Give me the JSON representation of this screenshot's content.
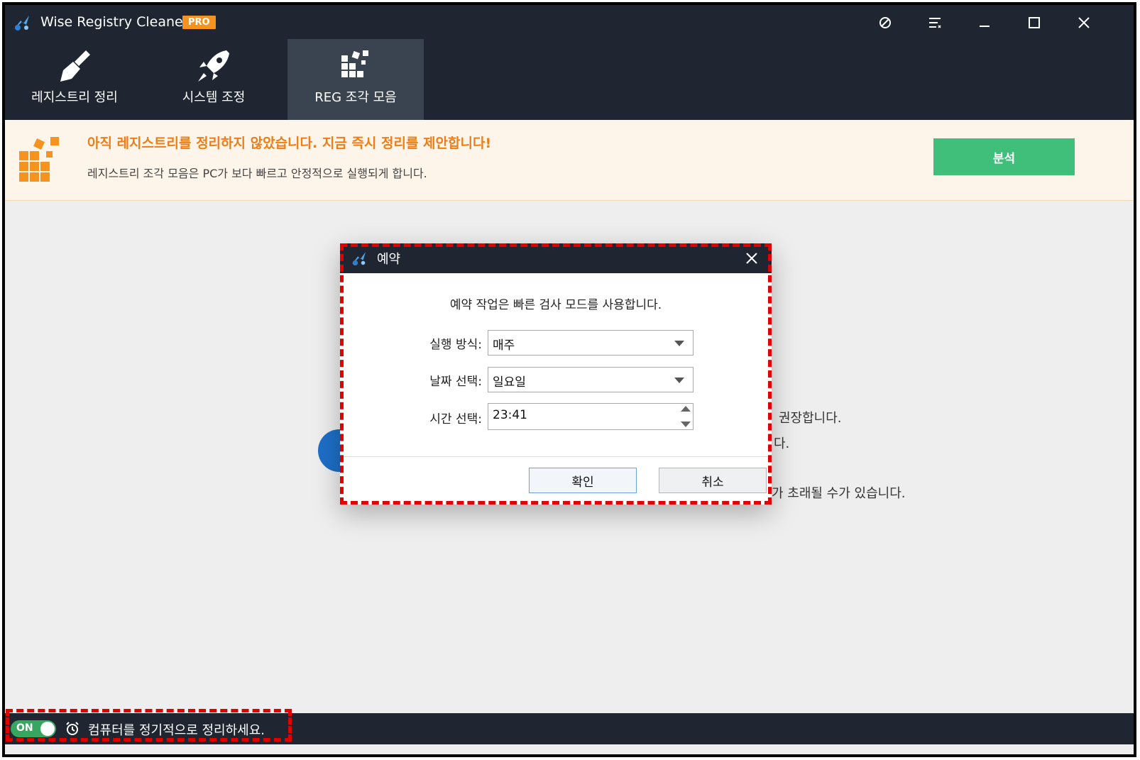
{
  "app": {
    "title": "Wise Registry Cleaner X",
    "badge": "PRO"
  },
  "window_controls": {
    "theme_icon": "theme-icon",
    "menu_icon": "menu-icon",
    "minimize_icon": "minimize-icon",
    "maximize_icon": "maximize-icon",
    "close_icon": "close-icon"
  },
  "tabs": [
    {
      "label": "레지스트리 정리",
      "icon": "broom-icon"
    },
    {
      "label": "시스템 조정",
      "icon": "rocket-icon"
    },
    {
      "label": "REG 조각 모음",
      "icon": "defrag-blocks-icon",
      "active": true
    }
  ],
  "banner": {
    "title": "아직 레지스트리를 정리하지 않았습니다. 지금 즉시 정리를 제안합니다!",
    "subtitle": "레지스트리 조각 모음은 PC가 보다 빠르고 안정적으로 실행되게 합니다.",
    "button": "분석",
    "icon": "defrag-blocks-icon"
  },
  "background_text": {
    "line1": "권장합니다.",
    "line2": "다.",
    "line3": "가 초래될 수가 있습니다."
  },
  "dialog": {
    "title": "예약",
    "message": "예약 작업은 빠른 검사 모드를 사용합니다.",
    "run_mode": {
      "label": "실행 방식:",
      "value": "매주"
    },
    "date": {
      "label": "날짜 선택:",
      "value": "일요일"
    },
    "time": {
      "label": "시간 선택:",
      "value": "23:41"
    },
    "ok": "확인",
    "cancel": "취소"
  },
  "footer": {
    "toggle": "ON",
    "text": "컴퓨터를 정기적으로 정리하세요.",
    "icon": "alarm-clock-icon"
  },
  "colors": {
    "titlebar": "#1f2631",
    "pro_badge": "#f6931f",
    "banner_title": "#ef7d16",
    "analyze_button": "#3fbf79",
    "toggle_on": "#37a660",
    "highlight_dash": "#e00000"
  }
}
